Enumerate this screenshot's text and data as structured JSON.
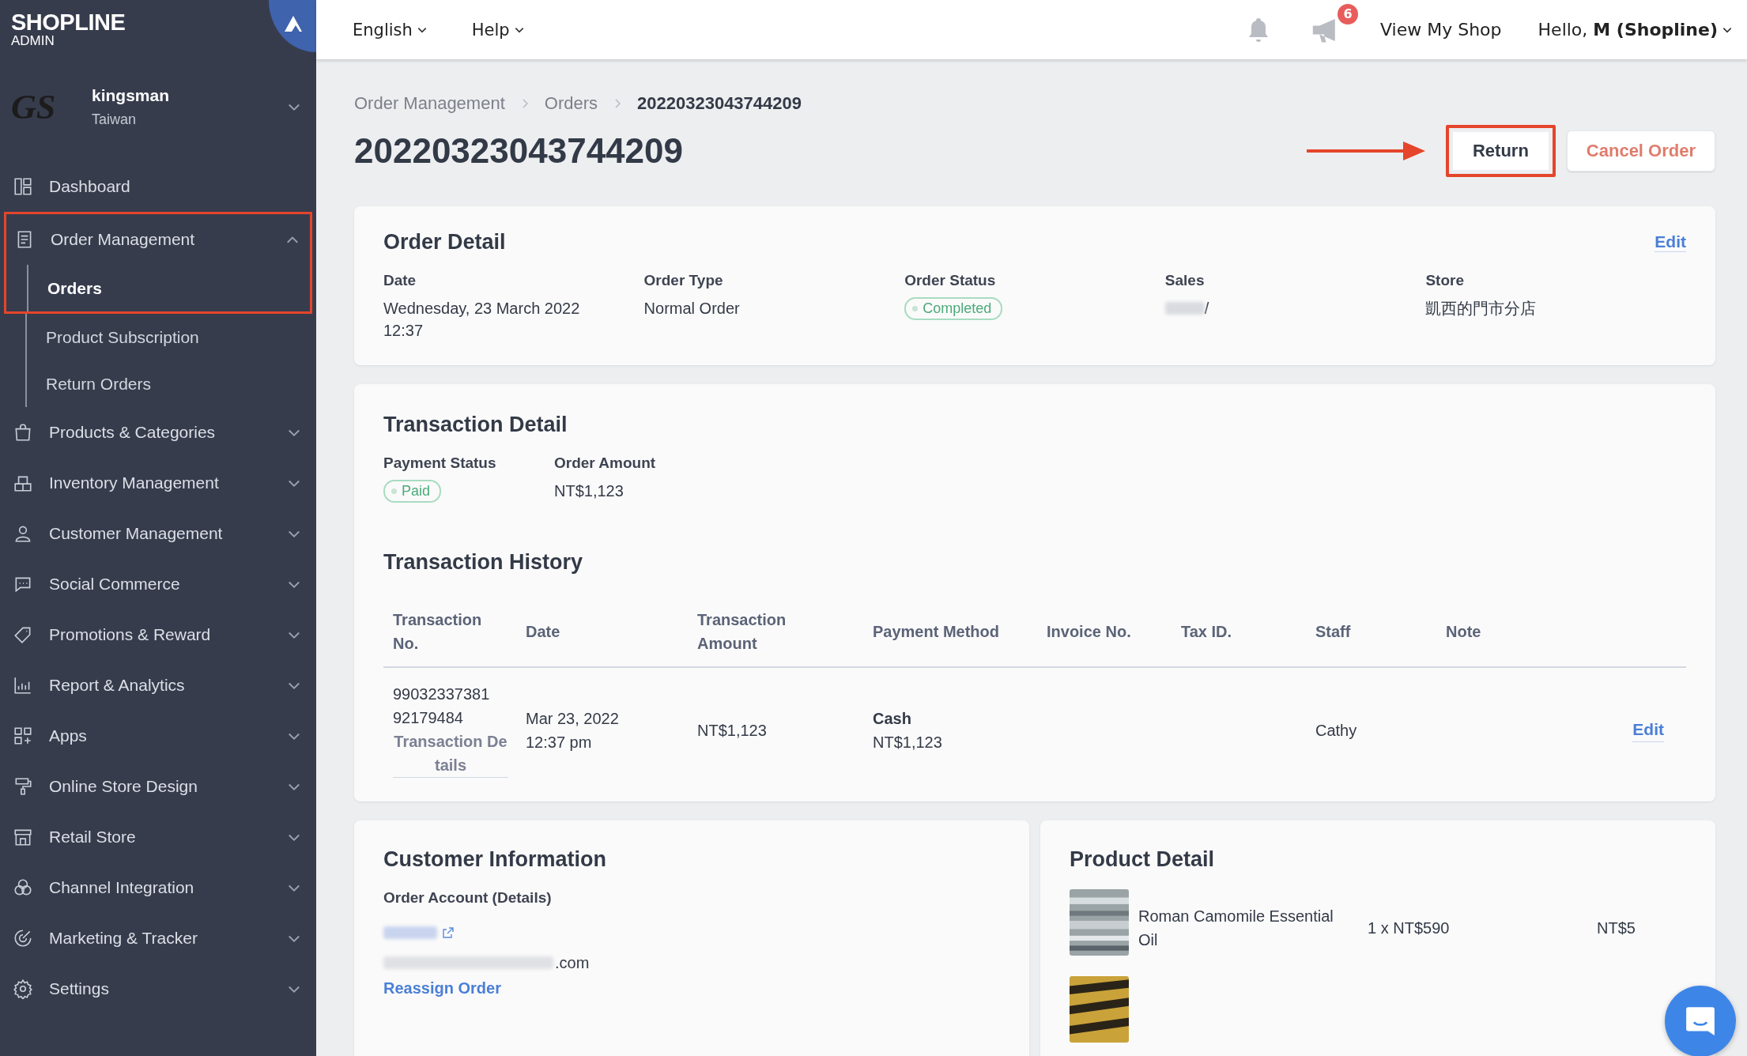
{
  "brand": {
    "name": "SHOPLINE",
    "sub": "ADMIN"
  },
  "store": {
    "logo": "GS",
    "name": "kingsman",
    "region": "Taiwan"
  },
  "sidebar": {
    "items": [
      {
        "kind": "link",
        "label": "Dashboard"
      },
      {
        "kind": "group",
        "label": "Order Management",
        "expanded": true,
        "highlighted": true,
        "children": [
          {
            "label": "Orders",
            "selected": true
          },
          {
            "label": "Product Subscription",
            "selected": false
          },
          {
            "label": "Return Orders",
            "selected": false
          }
        ]
      },
      {
        "kind": "group",
        "label": "Products & Categories",
        "expanded": false,
        "highlighted": false
      },
      {
        "kind": "group",
        "label": "Inventory Management",
        "expanded": false,
        "highlighted": false
      },
      {
        "kind": "group",
        "label": "Customer Management",
        "expanded": false,
        "highlighted": false
      },
      {
        "kind": "group",
        "label": "Social Commerce",
        "expanded": false,
        "highlighted": false
      },
      {
        "kind": "group",
        "label": "Promotions & Reward",
        "expanded": false,
        "highlighted": false
      },
      {
        "kind": "group",
        "label": "Report & Analytics",
        "expanded": false,
        "highlighted": false
      },
      {
        "kind": "group",
        "label": "Apps",
        "expanded": false,
        "highlighted": false
      },
      {
        "kind": "group",
        "label": "Online Store Design",
        "expanded": false,
        "highlighted": false
      },
      {
        "kind": "group",
        "label": "Retail Store",
        "expanded": false,
        "highlighted": false
      },
      {
        "kind": "group",
        "label": "Channel Integration",
        "expanded": false,
        "highlighted": false
      },
      {
        "kind": "group",
        "label": "Marketing & Tracker",
        "expanded": false,
        "highlighted": false
      },
      {
        "kind": "group",
        "label": "Settings",
        "expanded": false,
        "highlighted": false
      }
    ]
  },
  "header": {
    "menus": [
      "English",
      "Help"
    ],
    "notification_count": "6",
    "view_shop": "View My Shop",
    "greeting": "Hello, **M (Shopline)**"
  },
  "breadcrumb": [
    {
      "label": "Order Management",
      "current": false
    },
    {
      "label": "Orders",
      "current": false
    },
    {
      "label": "20220323043744209",
      "current": true
    }
  ],
  "title": "20220323043744209",
  "actions": [
    {
      "label": "Return",
      "kind": "default",
      "highlighted": true
    },
    {
      "label": "Cancel Order",
      "kind": "danger",
      "highlighted": false
    }
  ],
  "order_detail": {
    "title": "Order Detail",
    "edit": "Edit",
    "fields": [
      {
        "label": "Date",
        "kind": "text",
        "value": "Wednesday, 23 March 2022 12:37"
      },
      {
        "label": "Order Type",
        "kind": "text",
        "value": "Normal Order"
      },
      {
        "label": "Order Status",
        "kind": "status",
        "value": "Completed"
      },
      {
        "label": "Sales",
        "kind": "redacted",
        "value": "/"
      },
      {
        "label": "Store",
        "kind": "text",
        "value": "凱西的門市分店"
      }
    ]
  },
  "transaction_detail": {
    "title": "Transaction Detail",
    "fields": [
      {
        "label": "Payment Status",
        "kind": "status",
        "value": "Paid"
      },
      {
        "label": "Order Amount",
        "kind": "text",
        "value": "NT$1,123"
      }
    ]
  },
  "transaction_history": {
    "title": "Transaction History",
    "columns": [
      "Transaction No.",
      "Date",
      "Transaction Amount",
      "Payment Method",
      "Invoice No.",
      "Tax ID.",
      "Staff",
      "Note"
    ],
    "rows": [
      {
        "number": "99032337381 92179484",
        "details_link": "Transaction Details",
        "date": "Mar 23, 2022 12:37 pm",
        "amount": "NT$1,123",
        "method": "Cash",
        "method_amount": "NT$1,123",
        "staff": "Cathy",
        "edit": "Edit"
      }
    ]
  },
  "customer": {
    "title": "Customer Information",
    "label": "Order Account (Details)",
    "email_end": ".com",
    "reassign": "Reassign Order"
  },
  "product_detail": {
    "title": "Product Detail",
    "items": [
      {
        "kind": "full",
        "name": "Roman Camomile Essential Oil",
        "quantity": "1 x NT$590",
        "total": "NT$5"
      },
      {
        "kind": "picture"
      }
    ]
  }
}
